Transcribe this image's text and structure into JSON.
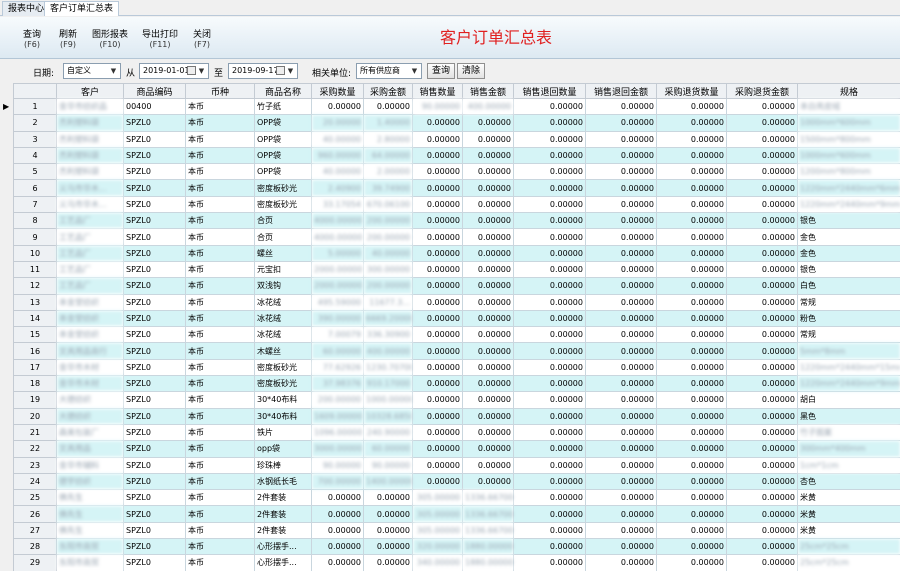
{
  "tabs": [
    {
      "label": "报表中心"
    },
    {
      "label": "客户订单汇总表"
    }
  ],
  "toolbar": {
    "query": {
      "label": "查询",
      "key": "(F6)"
    },
    "refresh": {
      "label": "刷新",
      "key": "(F9)"
    },
    "chart": {
      "label": "图形报表",
      "key": "(F10)"
    },
    "export": {
      "label": "导出打印",
      "key": "(F11)"
    },
    "close": {
      "label": "关闭",
      "key": "(F7)"
    }
  },
  "report_title": "客户订单汇总表",
  "filter": {
    "date_label": "日期:",
    "date_mode": "自定义",
    "from_label": "从",
    "from_date": "2019-01-01",
    "to_label": "至",
    "to_date": "2019-09-17",
    "unit_label": "相关单位:",
    "unit_value": "所有供应商",
    "query_button": "查询",
    "clear_button": "清除"
  },
  "row_marker": "▶",
  "table": {
    "columns": [
      "",
      "客户",
      "商品编码",
      "币种",
      "商品名称",
      "采购数量",
      "采购金额",
      "销售数量",
      "销售金额",
      "销售退回数量",
      "销售退回金额",
      "采购退货数量",
      "采购退货金额",
      "规格"
    ],
    "rows": [
      [
        "1",
        "金华市纺织品",
        "00400",
        "本币",
        "竹子纸",
        "0.00000",
        "0.00000",
        "90.00000",
        "400.00000",
        "0.00000",
        "0.00000",
        "0.00000",
        "0.00000",
        "本白亮皮绒"
      ],
      [
        "2",
        "杰利塑料袋",
        "SPZL0",
        "本币",
        "OPP袋",
        "20.00000",
        "1.40000",
        "0.00000",
        "0.00000",
        "0.00000",
        "0.00000",
        "0.00000",
        "0.00000",
        "1000mm*600mm"
      ],
      [
        "3",
        "杰利塑料袋",
        "SPZL0",
        "本币",
        "OPP袋",
        "40.00000",
        "2.80000",
        "0.00000",
        "0.00000",
        "0.00000",
        "0.00000",
        "0.00000",
        "0.00000",
        "1500mm*800mm"
      ],
      [
        "4",
        "杰利塑料袋",
        "SPZL0",
        "本币",
        "OPP袋",
        "960.00000",
        "64.00000",
        "0.00000",
        "0.00000",
        "0.00000",
        "0.00000",
        "0.00000",
        "0.00000",
        "1000mm*600mm"
      ],
      [
        "5",
        "杰利塑料袋",
        "SPZL0",
        "本币",
        "OPP袋",
        "40.00000",
        "2.00000",
        "0.00000",
        "0.00000",
        "0.00000",
        "0.00000",
        "0.00000",
        "0.00000",
        "1200mm*800mm"
      ],
      [
        "6",
        "义乌市华木...",
        "SPZL0",
        "本币",
        "密度板砂光",
        "2.40900",
        "39.74900",
        "0.00000",
        "0.00000",
        "0.00000",
        "0.00000",
        "0.00000",
        "0.00000",
        "1220mm*2440mm*6mm"
      ],
      [
        "7",
        "义乌市华木...",
        "SPZL0",
        "本币",
        "密度板砂光",
        "33.17054",
        "670.06100",
        "0.00000",
        "0.00000",
        "0.00000",
        "0.00000",
        "0.00000",
        "0.00000",
        "1220mm*2440mm*9mm"
      ],
      [
        "8",
        "工艺品厂",
        "SPZL0",
        "本币",
        "合页",
        "4000.00000",
        "200.00000",
        "0.00000",
        "0.00000",
        "0.00000",
        "0.00000",
        "0.00000",
        "0.00000",
        "银色"
      ],
      [
        "9",
        "工艺品厂",
        "SPZL0",
        "本币",
        "合页",
        "4000.00000",
        "200.00000",
        "0.00000",
        "0.00000",
        "0.00000",
        "0.00000",
        "0.00000",
        "0.00000",
        "金色"
      ],
      [
        "10",
        "工艺品厂",
        "SPZL0",
        "本币",
        "螺丝",
        "5.00000",
        "40.00000",
        "0.00000",
        "0.00000",
        "0.00000",
        "0.00000",
        "0.00000",
        "0.00000",
        "金色"
      ],
      [
        "11",
        "工艺品厂",
        "SPZL0",
        "本币",
        "元宝扣",
        "2000.00000",
        "300.00000",
        "0.00000",
        "0.00000",
        "0.00000",
        "0.00000",
        "0.00000",
        "0.00000",
        "银色"
      ],
      [
        "12",
        "工艺品厂",
        "SPZL0",
        "本币",
        "双浅钩",
        "2000.00000",
        "200.00000",
        "0.00000",
        "0.00000",
        "0.00000",
        "0.00000",
        "0.00000",
        "0.00000",
        "白色"
      ],
      [
        "13",
        "本金堂纺织",
        "SPZL0",
        "本币",
        "冰花绒",
        "495.59000",
        "11677.3...",
        "0.00000",
        "0.00000",
        "0.00000",
        "0.00000",
        "0.00000",
        "0.00000",
        "常规"
      ],
      [
        "14",
        "本金堂纺织",
        "SPZL0",
        "本币",
        "冰花绒",
        "390.00000",
        "6669.20000",
        "0.00000",
        "0.00000",
        "0.00000",
        "0.00000",
        "0.00000",
        "0.00000",
        "粉色"
      ],
      [
        "15",
        "本金堂纺织",
        "SPZL0",
        "本币",
        "冰花绒",
        "7.00079",
        "336.30900",
        "0.00000",
        "0.00000",
        "0.00000",
        "0.00000",
        "0.00000",
        "0.00000",
        "常规"
      ],
      [
        "16",
        "文具用品商行",
        "SPZL0",
        "本币",
        "木螺丝",
        "60.00000",
        "400.00000",
        "0.00000",
        "0.00000",
        "0.00000",
        "0.00000",
        "0.00000",
        "0.00000",
        "5mm*8mm"
      ],
      [
        "17",
        "金华市木材",
        "SPZL0",
        "本币",
        "密度板砂光",
        "77.62926",
        "1230.70700",
        "0.00000",
        "0.00000",
        "0.00000",
        "0.00000",
        "0.00000",
        "0.00000",
        "1220mm*2440mm*15mm"
      ],
      [
        "18",
        "金华市木材",
        "SPZL0",
        "本币",
        "密度板砂光",
        "37.98376",
        "910.17000",
        "0.00000",
        "0.00000",
        "0.00000",
        "0.00000",
        "0.00000",
        "0.00000",
        "1220mm*2440mm*9mm"
      ],
      [
        "19",
        "大德纺织",
        "SPZL0",
        "本币",
        "30*40布料",
        "200.00000",
        "1000.00000",
        "0.00000",
        "0.00000",
        "0.00000",
        "0.00000",
        "0.00000",
        "0.00000",
        "胡白"
      ],
      [
        "20",
        "大德纺织",
        "SPZL0",
        "本币",
        "30*40布料",
        "1609.00000",
        "10328.68500",
        "0.00000",
        "0.00000",
        "0.00000",
        "0.00000",
        "0.00000",
        "0.00000",
        "黑色"
      ],
      [
        "21",
        "森美包装厂",
        "SPZL0",
        "本币",
        "铁片",
        "1096.00000",
        "240.90000",
        "0.00000",
        "0.00000",
        "0.00000",
        "0.00000",
        "0.00000",
        "0.00000",
        "竹子图案"
      ],
      [
        "22",
        "文具用品",
        "SPZL0",
        "本币",
        "opp袋",
        "3000.00000",
        "60.00000",
        "0.00000",
        "0.00000",
        "0.00000",
        "0.00000",
        "0.00000",
        "0.00000",
        "300mm*400mm"
      ],
      [
        "23",
        "金华市辅料",
        "SPZL0",
        "本币",
        "珍珠棒",
        "90.00000",
        "90.00000",
        "0.00000",
        "0.00000",
        "0.00000",
        "0.00000",
        "0.00000",
        "0.00000",
        "1cm*1cm"
      ],
      [
        "24",
        "德宇纺织",
        "SPZL0",
        "本币",
        "水钢纸长毛",
        "700.00000",
        "1400.00000",
        "0.00000",
        "0.00000",
        "0.00000",
        "0.00000",
        "0.00000",
        "0.00000",
        "杏色"
      ],
      [
        "25",
        "佛先生",
        "SPZL0",
        "本币",
        "2件套装",
        "0.00000",
        "0.00000",
        "305.00000",
        "1336.66700",
        "0.00000",
        "0.00000",
        "0.00000",
        "0.00000",
        "米黄"
      ],
      [
        "26",
        "佛先生",
        "SPZL0",
        "本币",
        "2件套装",
        "0.00000",
        "0.00000",
        "305.00000",
        "1336.66700",
        "0.00000",
        "0.00000",
        "0.00000",
        "0.00000",
        "米黄"
      ],
      [
        "27",
        "佛先生",
        "SPZL0",
        "本币",
        "2件套装",
        "0.00000",
        "0.00000",
        "305.00000",
        "1336.66700",
        "0.00000",
        "0.00000",
        "0.00000",
        "0.00000",
        "米黄"
      ],
      [
        "28",
        "东阳市商贸",
        "SPZL0",
        "本币",
        "心形摆手...",
        "0.00000",
        "0.00000",
        "320.00000",
        "1880.00000",
        "0.00000",
        "0.00000",
        "0.00000",
        "0.00000",
        "25cm*25cm"
      ],
      [
        "29",
        "东阳市商贸",
        "SPZL0",
        "本币",
        "心形摆手...",
        "0.00000",
        "0.00000",
        "340.00000",
        "1880.00000",
        "0.00000",
        "0.00000",
        "0.00000",
        "0.00000",
        "25cm*25cm"
      ]
    ]
  }
}
